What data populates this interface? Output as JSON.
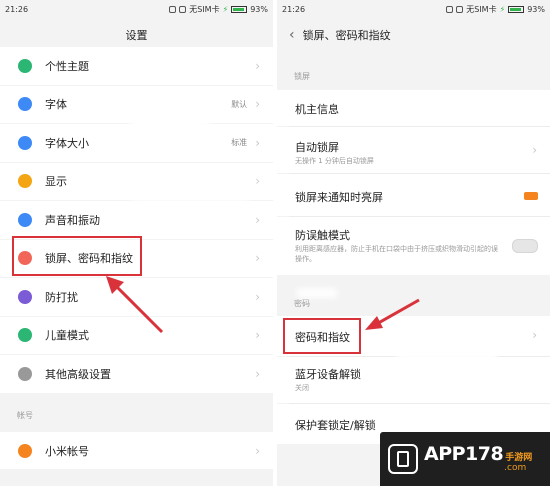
{
  "left": {
    "status": {
      "time": "21:26",
      "sim": "无SIM卡",
      "battery": "93%"
    },
    "title": "设置",
    "items": [
      {
        "label": "个性主题",
        "value": "",
        "icon": "palette-icon",
        "color": "#2bb673"
      },
      {
        "label": "字体",
        "value": "默认",
        "icon": "font-icon",
        "color": "#3d8af7"
      },
      {
        "label": "字体大小",
        "value": "标准",
        "icon": "font-size-icon",
        "color": "#3d8af7"
      },
      {
        "label": "显示",
        "value": "",
        "icon": "sun-icon",
        "color": "#f3a514"
      },
      {
        "label": "声音和振动",
        "value": "",
        "icon": "speaker-icon",
        "color": "#3d8af7"
      },
      {
        "label": "锁屏、密码和指纹",
        "value": "",
        "icon": "lock-icon",
        "color": "#f2665a"
      },
      {
        "label": "防打扰",
        "value": "",
        "icon": "moon-icon",
        "color": "#7b5bd6"
      },
      {
        "label": "儿童模式",
        "value": "",
        "icon": "child-icon",
        "color": "#2bb673"
      },
      {
        "label": "其他高级设置",
        "value": "",
        "icon": "more-icon",
        "color": "#999999"
      }
    ],
    "account_header": "帐号",
    "account_items": [
      {
        "label": "小米帐号",
        "icon": "mi-account-icon",
        "color": "#f5841f"
      }
    ]
  },
  "right": {
    "status": {
      "time": "21:26",
      "sim": "无SIM卡",
      "battery": "93%"
    },
    "title": "锁屏、密码和指纹",
    "section_lock": "锁屏",
    "owner_info": "机主信息",
    "auto_lock": {
      "label": "自动锁屏",
      "sub": "无操作 1 分钟后自动锁屏"
    },
    "notify_wake": "锁屏来通知时亮屏",
    "mistouch": {
      "label": "防误触模式",
      "sub": "利用距离感应器，防止手机在口袋中由于挤压或织物滑动引起的误操作。"
    },
    "section_security": "密码",
    "password_fingerprint": "密码和指纹",
    "bt_unlock": {
      "label": "蓝牙设备解锁",
      "sub": "关闭"
    },
    "cover_lock": "保护套锁定/解锁"
  },
  "watermark": {
    "brand": "APP178",
    "sub": "手游网",
    "domain": ".com"
  }
}
